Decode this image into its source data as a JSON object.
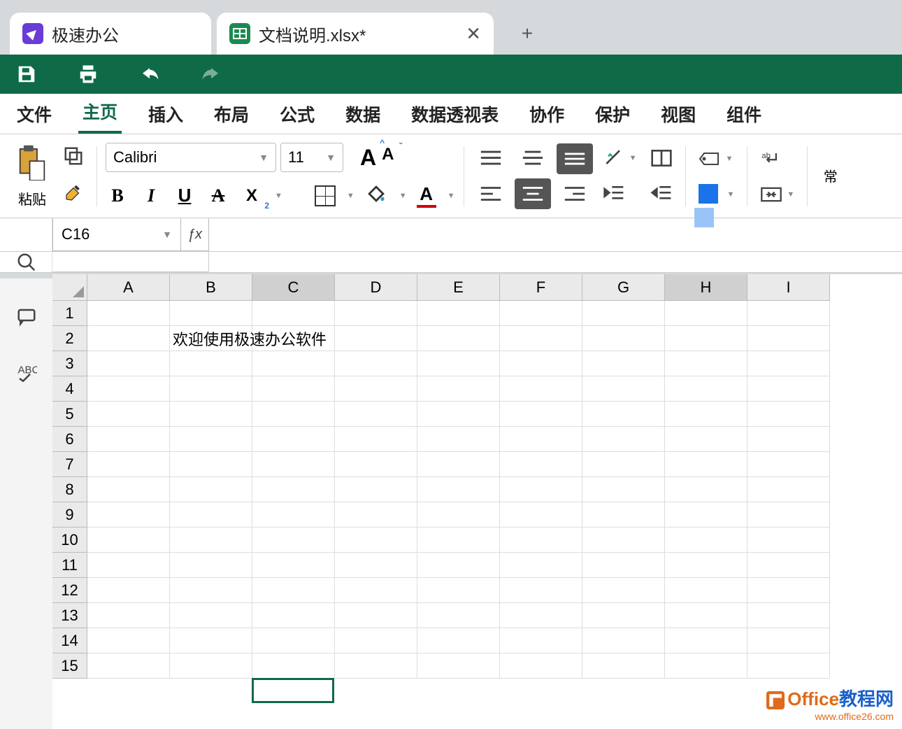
{
  "tabs": {
    "app_label": "极速办公",
    "doc_label": "文档说明.xlsx*",
    "close_glyph": "✕",
    "plus_glyph": "+"
  },
  "menu": {
    "file": "文件",
    "home": "主页",
    "insert": "插入",
    "layout": "布局",
    "formula": "公式",
    "data": "数据",
    "pivot": "数据透视表",
    "collab": "协作",
    "protect": "保护",
    "view": "视图",
    "component": "组件"
  },
  "ribbon": {
    "paste": "粘贴",
    "font_name": "Calibri",
    "font_size": "11",
    "bold": "B",
    "italic": "I",
    "underline": "U",
    "strike": "A",
    "subx": "X",
    "growA": "A",
    "shrinkA": "A",
    "fontcolorA": "A",
    "general_mode": "常"
  },
  "namebox": "C16",
  "fx": "ƒx",
  "columns": [
    "A",
    "B",
    "C",
    "D",
    "E",
    "F",
    "G",
    "H",
    "I"
  ],
  "selected_col": "C",
  "highlight_col": "H",
  "rows": [
    "1",
    "2",
    "3",
    "4",
    "5",
    "6",
    "7",
    "8",
    "9",
    "10",
    "11",
    "12",
    "13",
    "14",
    "15"
  ],
  "cell_b2": "欢迎使用极速办公软件",
  "watermark": {
    "line1a": "Office",
    "line1b": "教程网",
    "line2": "www.office26.com"
  }
}
